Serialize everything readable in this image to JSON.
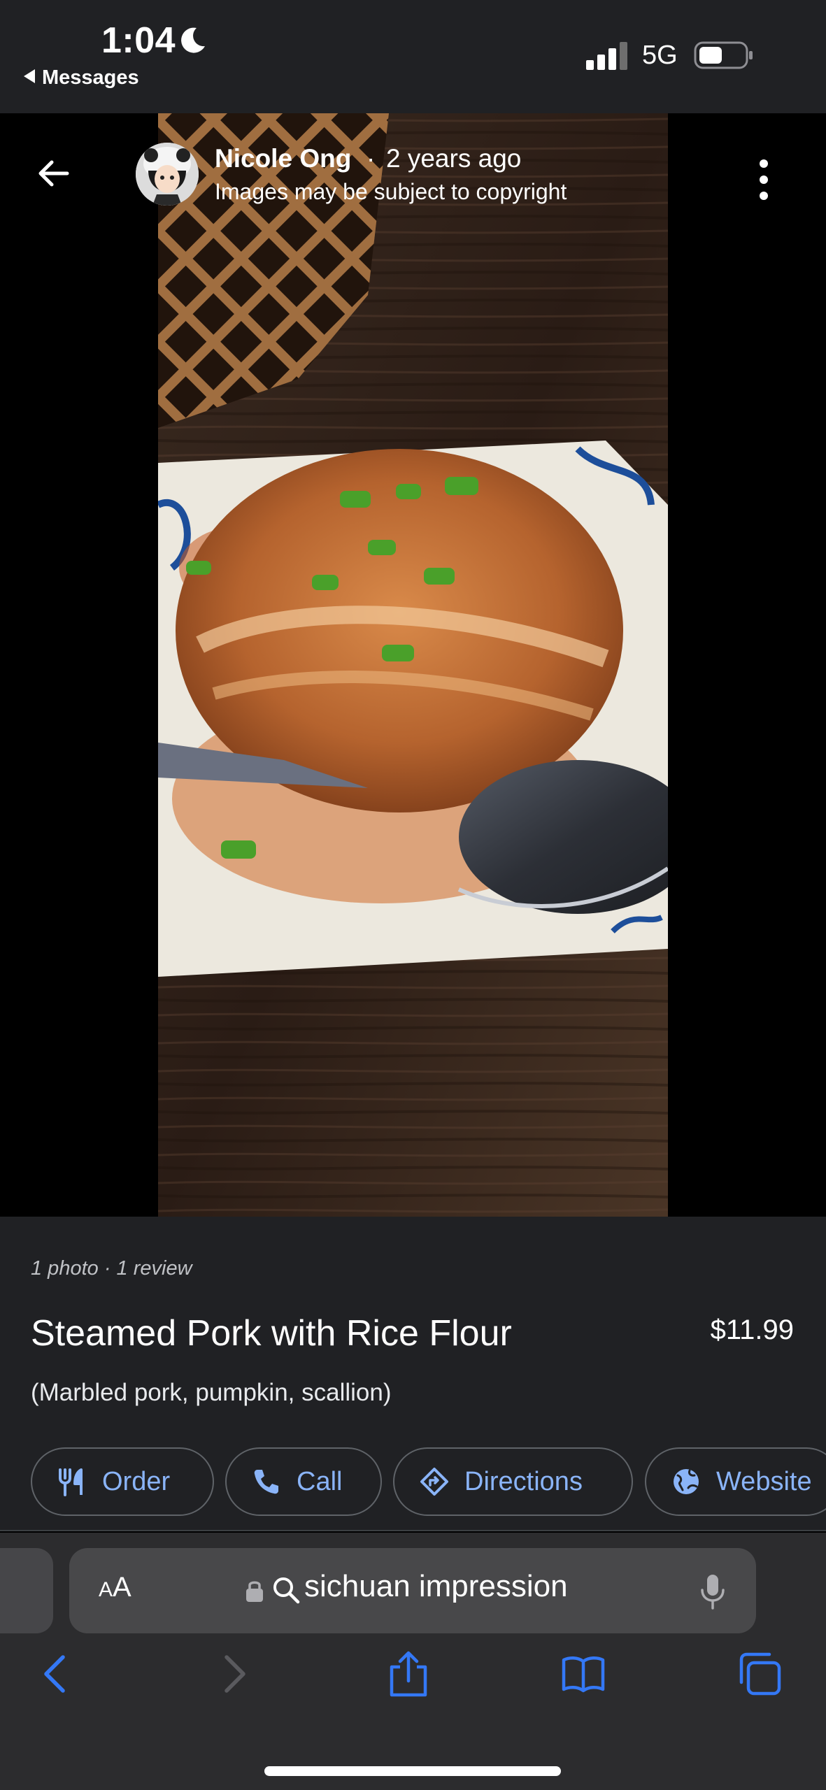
{
  "status_bar": {
    "time": "1:04",
    "back_app": "Messages",
    "network": "5G",
    "icons": [
      "moon-icon",
      "signal-icon",
      "battery-icon"
    ]
  },
  "photo_viewer": {
    "author": "Nicole Ong",
    "separator": "·",
    "age": "2 years ago",
    "notice": "Images may be subject to copyright",
    "icons": [
      "back-arrow-icon",
      "more-options-icon"
    ]
  },
  "dish": {
    "counts": "1 photo · 1 review",
    "name": "Steamed Pork with Rice Flour",
    "price": "$11.99",
    "description": "(Marbled pork, pumpkin, scallion)"
  },
  "actions": [
    {
      "label": "Order",
      "icon": "utensils-icon"
    },
    {
      "label": "Call",
      "icon": "phone-icon"
    },
    {
      "label": "Directions",
      "icon": "directions-icon"
    },
    {
      "label": "Website",
      "icon": "globe-icon"
    }
  ],
  "safari": {
    "text_size_small": "A",
    "text_size_big": "A",
    "address": "sichuan impression",
    "icons": [
      "lock-icon",
      "search-icon",
      "microphone-icon",
      "back-icon",
      "forward-icon",
      "share-icon",
      "bookmarks-icon",
      "tabs-icon"
    ]
  },
  "colors": {
    "panel": "#202124",
    "accent": "#8ab4f8",
    "safari_bar": "#2c2c2e",
    "ios_blue": "#3478f6"
  }
}
